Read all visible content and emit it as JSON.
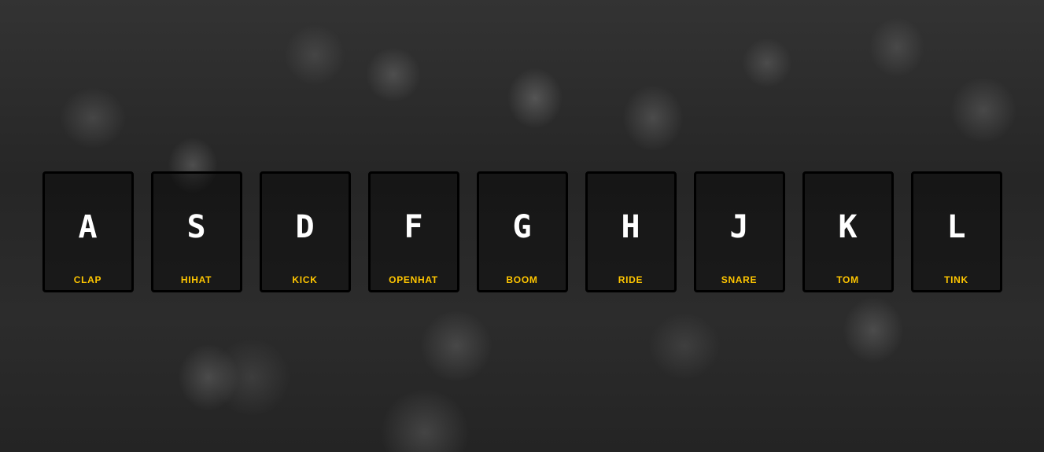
{
  "keys": [
    {
      "letter": "A",
      "sound": "CLAP"
    },
    {
      "letter": "S",
      "sound": "HIHAT"
    },
    {
      "letter": "D",
      "sound": "KICK"
    },
    {
      "letter": "F",
      "sound": "OPENHAT"
    },
    {
      "letter": "G",
      "sound": "BOOM"
    },
    {
      "letter": "H",
      "sound": "RIDE"
    },
    {
      "letter": "J",
      "sound": "SNARE"
    },
    {
      "letter": "K",
      "sound": "TOM"
    },
    {
      "letter": "L",
      "sound": "TINK"
    }
  ],
  "colors": {
    "sound_label": "#ffc600",
    "letter": "#ffffff",
    "border": "#000000"
  }
}
